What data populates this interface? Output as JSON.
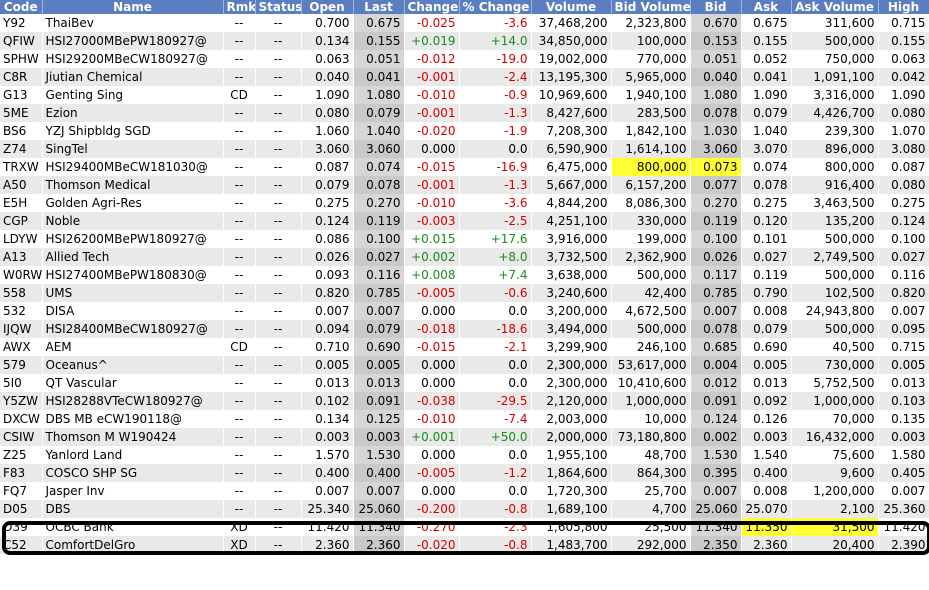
{
  "columns": [
    "Code",
    "Name",
    "Rmk",
    "Status",
    "Open",
    "Last",
    "Change",
    "% Change",
    "Volume",
    "Bid Volume",
    "Bid",
    "Ask",
    "Ask Volume",
    "High"
  ],
  "rows": [
    {
      "code": "Y92",
      "name": "ThaiBev",
      "rmk": "--",
      "status": "--",
      "open": "0.700",
      "last": "0.675",
      "change": "-0.025",
      "pct": "-3.6",
      "volume": "37,468,200",
      "bidvol": "2,323,800",
      "bid": "0.670",
      "ask": "0.675",
      "askvol": "311,600",
      "high": "0.715",
      "dir": "neg"
    },
    {
      "code": "QFIW",
      "name": "HSI27000MBePW180927@",
      "rmk": "--",
      "status": "--",
      "open": "0.134",
      "last": "0.155",
      "change": "+0.019",
      "pct": "+14.0",
      "volume": "34,850,000",
      "bidvol": "100,000",
      "bid": "0.153",
      "ask": "0.155",
      "askvol": "500,000",
      "high": "0.155",
      "dir": "pos"
    },
    {
      "code": "SPHW",
      "name": "HSI29200MBeCW180927@",
      "rmk": "--",
      "status": "--",
      "open": "0.063",
      "last": "0.051",
      "change": "-0.012",
      "pct": "-19.0",
      "volume": "19,002,000",
      "bidvol": "770,000",
      "bid": "0.051",
      "ask": "0.052",
      "askvol": "750,000",
      "high": "0.063",
      "dir": "neg"
    },
    {
      "code": "C8R",
      "name": "Jiutian Chemical",
      "rmk": "--",
      "status": "--",
      "open": "0.040",
      "last": "0.041",
      "change": "-0.001",
      "pct": "-2.4",
      "volume": "13,195,300",
      "bidvol": "5,965,000",
      "bid": "0.040",
      "ask": "0.041",
      "askvol": "1,091,100",
      "high": "0.042",
      "dir": "neg"
    },
    {
      "code": "G13",
      "name": "Genting Sing",
      "rmk": "CD",
      "status": "--",
      "open": "1.090",
      "last": "1.080",
      "change": "-0.010",
      "pct": "-0.9",
      "volume": "10,969,600",
      "bidvol": "1,940,100",
      "bid": "1.080",
      "ask": "1.090",
      "askvol": "3,316,000",
      "high": "1.090",
      "dir": "neg"
    },
    {
      "code": "5ME",
      "name": "Ezion",
      "rmk": "--",
      "status": "--",
      "open": "0.080",
      "last": "0.079",
      "change": "-0.001",
      "pct": "-1.3",
      "volume": "8,427,600",
      "bidvol": "283,500",
      "bid": "0.078",
      "ask": "0.079",
      "askvol": "4,426,700",
      "high": "0.080",
      "dir": "neg"
    },
    {
      "code": "BS6",
      "name": "YZJ Shipbldg SGD",
      "rmk": "--",
      "status": "--",
      "open": "1.060",
      "last": "1.040",
      "change": "-0.020",
      "pct": "-1.9",
      "volume": "7,208,300",
      "bidvol": "1,842,100",
      "bid": "1.030",
      "ask": "1.040",
      "askvol": "239,300",
      "high": "1.070",
      "dir": "neg"
    },
    {
      "code": "Z74",
      "name": "SingTel",
      "rmk": "--",
      "status": "--",
      "open": "3.060",
      "last": "3.060",
      "change": "0.000",
      "pct": "0.0",
      "volume": "6,590,900",
      "bidvol": "1,614,100",
      "bid": "3.060",
      "ask": "3.070",
      "askvol": "896,000",
      "high": "3.080",
      "dir": "flat"
    },
    {
      "code": "TRXW",
      "name": "HSI29400MBeCW181030@",
      "rmk": "--",
      "status": "--",
      "open": "0.087",
      "last": "0.074",
      "change": "-0.015",
      "pct": "-16.9",
      "volume": "6,475,000",
      "bidvol": "800,000",
      "bid": "0.073",
      "ask": "0.074",
      "askvol": "800,000",
      "high": "0.087",
      "dir": "neg",
      "hl_bid": true
    },
    {
      "code": "A50",
      "name": "Thomson Medical",
      "rmk": "--",
      "status": "--",
      "open": "0.079",
      "last": "0.078",
      "change": "-0.001",
      "pct": "-1.3",
      "volume": "5,667,000",
      "bidvol": "6,157,200",
      "bid": "0.077",
      "ask": "0.078",
      "askvol": "916,400",
      "high": "0.080",
      "dir": "neg"
    },
    {
      "code": "E5H",
      "name": "Golden Agri-Res",
      "rmk": "--",
      "status": "--",
      "open": "0.275",
      "last": "0.270",
      "change": "-0.010",
      "pct": "-3.6",
      "volume": "4,844,200",
      "bidvol": "8,086,300",
      "bid": "0.270",
      "ask": "0.275",
      "askvol": "3,463,500",
      "high": "0.275",
      "dir": "neg"
    },
    {
      "code": "CGP",
      "name": "Noble",
      "rmk": "--",
      "status": "--",
      "open": "0.124",
      "last": "0.119",
      "change": "-0.003",
      "pct": "-2.5",
      "volume": "4,251,100",
      "bidvol": "330,000",
      "bid": "0.119",
      "ask": "0.120",
      "askvol": "135,200",
      "high": "0.124",
      "dir": "neg"
    },
    {
      "code": "LDYW",
      "name": "HSI26200MBePW180927@",
      "rmk": "--",
      "status": "--",
      "open": "0.086",
      "last": "0.100",
      "change": "+0.015",
      "pct": "+17.6",
      "volume": "3,916,000",
      "bidvol": "199,000",
      "bid": "0.100",
      "ask": "0.101",
      "askvol": "500,000",
      "high": "0.100",
      "dir": "pos"
    },
    {
      "code": "A13",
      "name": "Allied Tech",
      "rmk": "--",
      "status": "--",
      "open": "0.026",
      "last": "0.027",
      "change": "+0.002",
      "pct": "+8.0",
      "volume": "3,732,500",
      "bidvol": "2,362,900",
      "bid": "0.026",
      "ask": "0.027",
      "askvol": "2,749,500",
      "high": "0.027",
      "dir": "pos"
    },
    {
      "code": "W0RW",
      "name": "HSI27400MBePW180830@",
      "rmk": "--",
      "status": "--",
      "open": "0.093",
      "last": "0.116",
      "change": "+0.008",
      "pct": "+7.4",
      "volume": "3,638,000",
      "bidvol": "500,000",
      "bid": "0.117",
      "ask": "0.119",
      "askvol": "500,000",
      "high": "0.116",
      "dir": "pos"
    },
    {
      "code": "558",
      "name": "UMS",
      "rmk": "--",
      "status": "--",
      "open": "0.820",
      "last": "0.785",
      "change": "-0.005",
      "pct": "-0.6",
      "volume": "3,240,600",
      "bidvol": "42,400",
      "bid": "0.785",
      "ask": "0.790",
      "askvol": "102,500",
      "high": "0.820",
      "dir": "neg"
    },
    {
      "code": "532",
      "name": "DISA",
      "rmk": "--",
      "status": "--",
      "open": "0.007",
      "last": "0.007",
      "change": "0.000",
      "pct": "0.0",
      "volume": "3,200,000",
      "bidvol": "4,672,500",
      "bid": "0.007",
      "ask": "0.008",
      "askvol": "24,943,800",
      "high": "0.007",
      "dir": "flat"
    },
    {
      "code": "IJQW",
      "name": "HSI28400MBeCW180927@",
      "rmk": "--",
      "status": "--",
      "open": "0.094",
      "last": "0.079",
      "change": "-0.018",
      "pct": "-18.6",
      "volume": "3,494,000",
      "bidvol": "500,000",
      "bid": "0.078",
      "ask": "0.079",
      "askvol": "500,000",
      "high": "0.095",
      "dir": "neg"
    },
    {
      "code": "AWX",
      "name": "AEM",
      "rmk": "CD",
      "status": "--",
      "open": "0.710",
      "last": "0.690",
      "change": "-0.015",
      "pct": "-2.1",
      "volume": "3,299,900",
      "bidvol": "246,100",
      "bid": "0.685",
      "ask": "0.690",
      "askvol": "40,500",
      "high": "0.715",
      "dir": "neg"
    },
    {
      "code": "579",
      "name": "Oceanus^",
      "rmk": "--",
      "status": "--",
      "open": "0.005",
      "last": "0.005",
      "change": "0.000",
      "pct": "0.0",
      "volume": "2,300,000",
      "bidvol": "53,617,000",
      "bid": "0.004",
      "ask": "0.005",
      "askvol": "730,000",
      "high": "0.005",
      "dir": "flat"
    },
    {
      "code": "5I0",
      "name": "QT Vascular",
      "rmk": "--",
      "status": "--",
      "open": "0.013",
      "last": "0.013",
      "change": "0.000",
      "pct": "0.0",
      "volume": "2,300,000",
      "bidvol": "10,410,600",
      "bid": "0.012",
      "ask": "0.013",
      "askvol": "5,752,500",
      "high": "0.013",
      "dir": "flat"
    },
    {
      "code": "Y5ZW",
      "name": "HSI28288VTeCW180927@",
      "rmk": "--",
      "status": "--",
      "open": "0.102",
      "last": "0.091",
      "change": "-0.038",
      "pct": "-29.5",
      "volume": "2,120,000",
      "bidvol": "1,000,000",
      "bid": "0.091",
      "ask": "0.092",
      "askvol": "1,000,000",
      "high": "0.103",
      "dir": "neg"
    },
    {
      "code": "DXCW",
      "name": "DBS MB eCW190118@",
      "rmk": "--",
      "status": "--",
      "open": "0.134",
      "last": "0.125",
      "change": "-0.010",
      "pct": "-7.4",
      "volume": "2,003,000",
      "bidvol": "10,000",
      "bid": "0.124",
      "ask": "0.126",
      "askvol": "70,000",
      "high": "0.135",
      "dir": "neg"
    },
    {
      "code": "CSIW",
      "name": "Thomson M W190424",
      "rmk": "--",
      "status": "--",
      "open": "0.003",
      "last": "0.003",
      "change": "+0.001",
      "pct": "+50.0",
      "volume": "2,000,000",
      "bidvol": "73,180,800",
      "bid": "0.002",
      "ask": "0.003",
      "askvol": "16,432,000",
      "high": "0.003",
      "dir": "pos"
    },
    {
      "code": "Z25",
      "name": "Yanlord Land",
      "rmk": "--",
      "status": "--",
      "open": "1.570",
      "last": "1.530",
      "change": "0.000",
      "pct": "0.0",
      "volume": "1,955,100",
      "bidvol": "48,700",
      "bid": "1.530",
      "ask": "1.540",
      "askvol": "75,600",
      "high": "1.580",
      "dir": "flat"
    },
    {
      "code": "F83",
      "name": "COSCO SHP SG",
      "rmk": "--",
      "status": "--",
      "open": "0.400",
      "last": "0.400",
      "change": "-0.005",
      "pct": "-1.2",
      "volume": "1,864,600",
      "bidvol": "864,300",
      "bid": "0.395",
      "ask": "0.400",
      "askvol": "9,600",
      "high": "0.405",
      "dir": "neg"
    },
    {
      "code": "FQ7",
      "name": "Jasper Inv",
      "rmk": "--",
      "status": "--",
      "open": "0.007",
      "last": "0.007",
      "change": "0.000",
      "pct": "0.0",
      "volume": "1,720,300",
      "bidvol": "25,700",
      "bid": "0.007",
      "ask": "0.008",
      "askvol": "1,200,000",
      "high": "0.007",
      "dir": "flat"
    },
    {
      "code": "D05",
      "name": "DBS",
      "rmk": "--",
      "status": "--",
      "open": "25.340",
      "last": "25.060",
      "change": "-0.200",
      "pct": "-0.8",
      "volume": "1,689,100",
      "bidvol": "4,700",
      "bid": "25.060",
      "ask": "25.070",
      "askvol": "2,100",
      "high": "25.360",
      "dir": "neg"
    },
    {
      "code": "O39",
      "name": "OCBC Bank",
      "rmk": "XD",
      "status": "--",
      "open": "11.420",
      "last": "11.340",
      "change": "-0.270",
      "pct": "-2.3",
      "volume": "1,605,800",
      "bidvol": "25,500",
      "bid": "11.340",
      "ask": "11.350",
      "askvol": "31,500",
      "high": "11.420",
      "dir": "neg",
      "hl_ask": true
    },
    {
      "code": "C52",
      "name": "ComfortDelGro",
      "rmk": "XD",
      "status": "--",
      "open": "2.360",
      "last": "2.360",
      "change": "-0.020",
      "pct": "-0.8",
      "volume": "1,483,700",
      "bidvol": "292,000",
      "bid": "2.350",
      "ask": "2.360",
      "askvol": "20,400",
      "high": "2.390",
      "dir": "neg"
    }
  ]
}
